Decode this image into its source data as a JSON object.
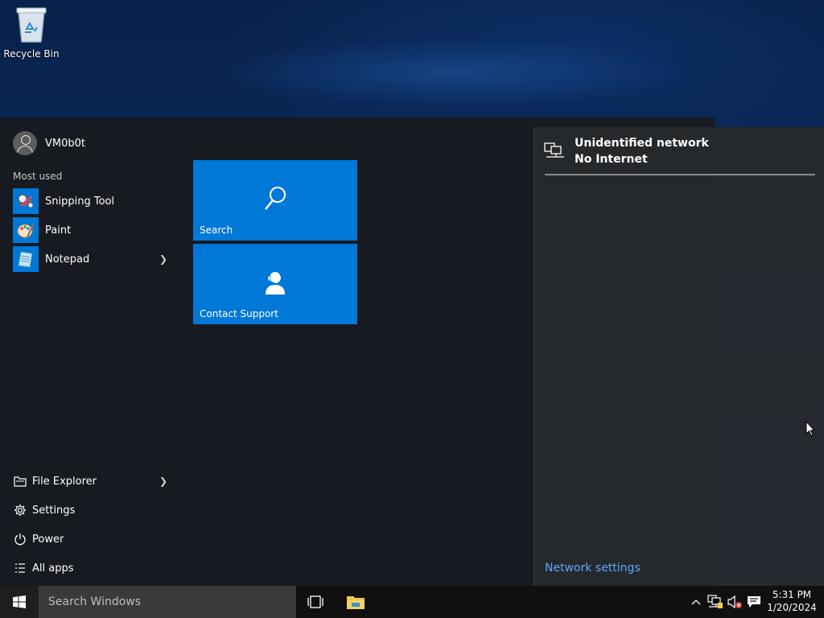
{
  "desktop": {
    "recycle_bin_label": "Recycle Bin"
  },
  "start_menu": {
    "user_name": "VM0b0t",
    "most_used_header": "Most used",
    "most_used": [
      {
        "label": "Snipping Tool",
        "icon": "snipping-tool-icon"
      },
      {
        "label": "Paint",
        "icon": "paint-icon"
      },
      {
        "label": "Notepad",
        "icon": "notepad-icon"
      }
    ],
    "bottom_items": [
      {
        "label": "File Explorer",
        "icon": "file-explorer-icon"
      },
      {
        "label": "Settings",
        "icon": "gear-icon"
      },
      {
        "label": "Power",
        "icon": "power-icon"
      },
      {
        "label": "All apps",
        "icon": "all-apps-icon"
      }
    ],
    "tiles": [
      {
        "label": "Search",
        "icon": "search-icon"
      },
      {
        "label": "Contact Support",
        "icon": "support-person-icon"
      }
    ]
  },
  "network_flyout": {
    "title": "Unidentified network",
    "status": "No Internet",
    "settings_link": "Network settings"
  },
  "taskbar": {
    "search_placeholder": "Search Windows",
    "time": "5:31 PM",
    "date": "1/20/2024"
  },
  "colors": {
    "accent": "#0078d7",
    "link": "#59a9ff"
  }
}
